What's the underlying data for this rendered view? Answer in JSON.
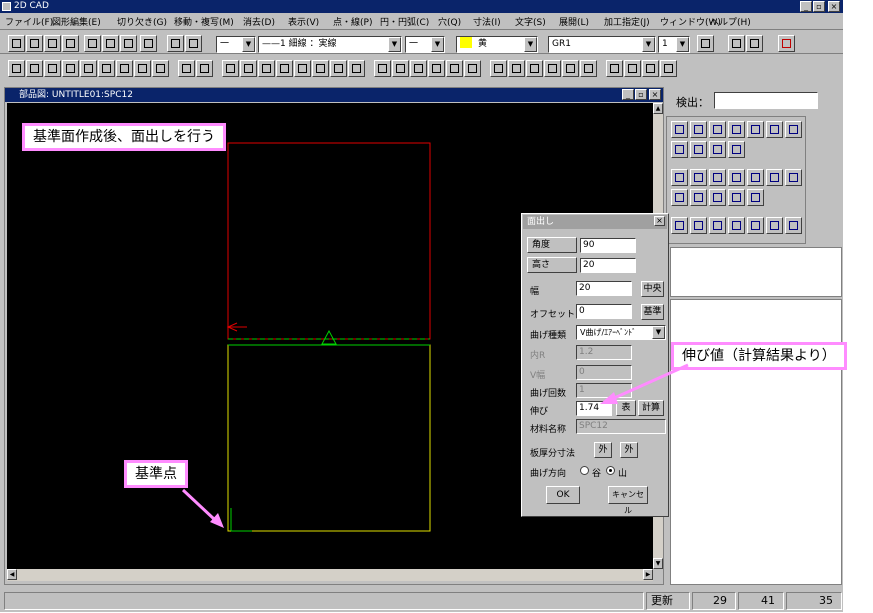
{
  "app": {
    "title": "2D CAD"
  },
  "menu": [
    "ファイル(F)",
    "図形編集(E)",
    "切り欠き(G)",
    "移動・複写(M)",
    "消去(D)",
    "表示(V)",
    "点・線(P)",
    "円・円弧(C)",
    "穴(Q)",
    "寸法(I)",
    "文字(S)",
    "展開(L)",
    "加工指定(J)",
    "ウィンドウ(W)",
    "ヘルプ(H)"
  ],
  "toolbar": {
    "line_style": "一",
    "line_type": "——1 細線 ：実線",
    "line_width": "一",
    "color_name": "黄",
    "color_hex": "#ffff00",
    "group": "GR1",
    "layer": "1"
  },
  "drawing": {
    "title": "部品図: UNTITLE01:SPC12"
  },
  "callouts": {
    "top": "基準面作成後、面出しを行う",
    "stretch": "伸び値（計算結果より）",
    "base": "基準点"
  },
  "search": {
    "label": "検出：",
    "value": ""
  },
  "dialog": {
    "title": "面出し",
    "angle_label": "角度",
    "angle_value": "90",
    "height_label": "高さ",
    "height_value": "20",
    "width_label": "幅",
    "width_value": "20",
    "center_btn": "中央",
    "offset_label": "オフセット",
    "offset_value": "0",
    "base_btn": "基準",
    "bend_type_label": "曲げ種類",
    "bend_type_value": "V曲げ/ｴｱｰﾍﾞﾝﾄﾞ",
    "inner_r_label": "内R",
    "inner_r_value": "1.2",
    "v_width_label": "V幅",
    "v_width_value": "0",
    "bend_count_label": "曲げ回数",
    "bend_count_value": "1",
    "stretch_label": "伸び",
    "stretch_value": "1.74",
    "table_btn": "表",
    "calc_btn": "計算",
    "material_label": "材料名称",
    "material_value": "SPC12",
    "thickness_label": "板厚分寸法",
    "outer_btn1": "外",
    "outer_btn2": "外",
    "direction_label": "曲げ方向",
    "valley_label": "谷",
    "mountain_label": "山",
    "ok_btn": "OK",
    "cancel_btn": "キャンセル"
  },
  "status": {
    "mode": "更新",
    "x": "29",
    "y": "41",
    "z": "35"
  }
}
